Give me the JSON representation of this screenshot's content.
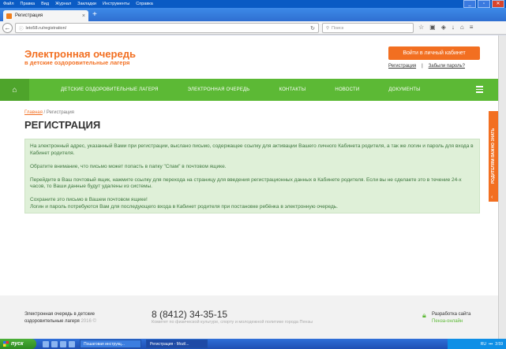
{
  "browser": {
    "menu": [
      "Файл",
      "Правка",
      "Вид",
      "Журнал",
      "Закладки",
      "Инструменты",
      "Справка"
    ],
    "tab_title": "Регистрация",
    "url": "leto58.ru/registration/",
    "search_placeholder": "Поиск"
  },
  "site": {
    "logo_line1": "Электронная очередь",
    "logo_line2": "в детские оздоровительные лагеря",
    "login_button": "Войти в личный кабинет",
    "link_register": "Регистрация",
    "link_separator": "|",
    "link_forgot": "Забыли пароль?"
  },
  "nav": {
    "items": [
      "ДЕТСКИЕ ОЗДОРОВИТЕЛЬНЫЕ ЛАГЕРЯ",
      "ЭЛЕКТРОННАЯ ОЧЕРЕДЬ",
      "КОНТАКТЫ",
      "НОВОСТИ",
      "ДОКУМЕНТЫ"
    ]
  },
  "breadcrumb": {
    "home": "Главная",
    "current": "/ Регистрация"
  },
  "page_title": "РЕГИСТРАЦИЯ",
  "message": {
    "p1": "На электронный адрес, указанный Вами при регистрации, выслано письмо, содержащее ссылку для активации Вашего личного Кабинета родителя, а так же логин и пароль для входа в Кабинет родителя.",
    "p2": "Обратите внимание, что письмо может попасть в папку \"Спам\" в почтовом ящике.",
    "p3": "Перейдите в Ваш почтовый ящик, нажмите ссылку для перехода на страницу для введения регистрационных данных в Кабинете родителя. Если вы не сделаете это в течение 24-х часов, то Ваши данные будут удалены из системы.",
    "p4": "Сохраните это письмо в Вашем почтовом ящике!",
    "p5": "Логин и пароль потребуются Вам для последующего входа в Кабинет родителя при постановке ребёнка в электронную очередь."
  },
  "side_tab": "РОДИТЕЛЯМ ВАЖНО ЗНАТЬ",
  "footer": {
    "text_line1": "Электронная очередь в детские",
    "text_line2": "оздоровительные лагеря",
    "year": "2016 ©",
    "phone": "8 (8412) 34-35-15",
    "note": "Комитет по физической культуре, спорту и молодежной политике города Пензы",
    "dev_label": "Разработка сайта",
    "dev_company": "Пенза-онлайн"
  },
  "taskbar": {
    "start": "пуск",
    "tasks": [
      "Пошаговая инструкц...",
      "Регистрация - Mozil..."
    ],
    "lang": "RU",
    "clock": "3:59"
  },
  "colors": {
    "accent_orange": "#f26f21",
    "nav_green": "#5cb935",
    "message_bg": "#dff0d8"
  }
}
